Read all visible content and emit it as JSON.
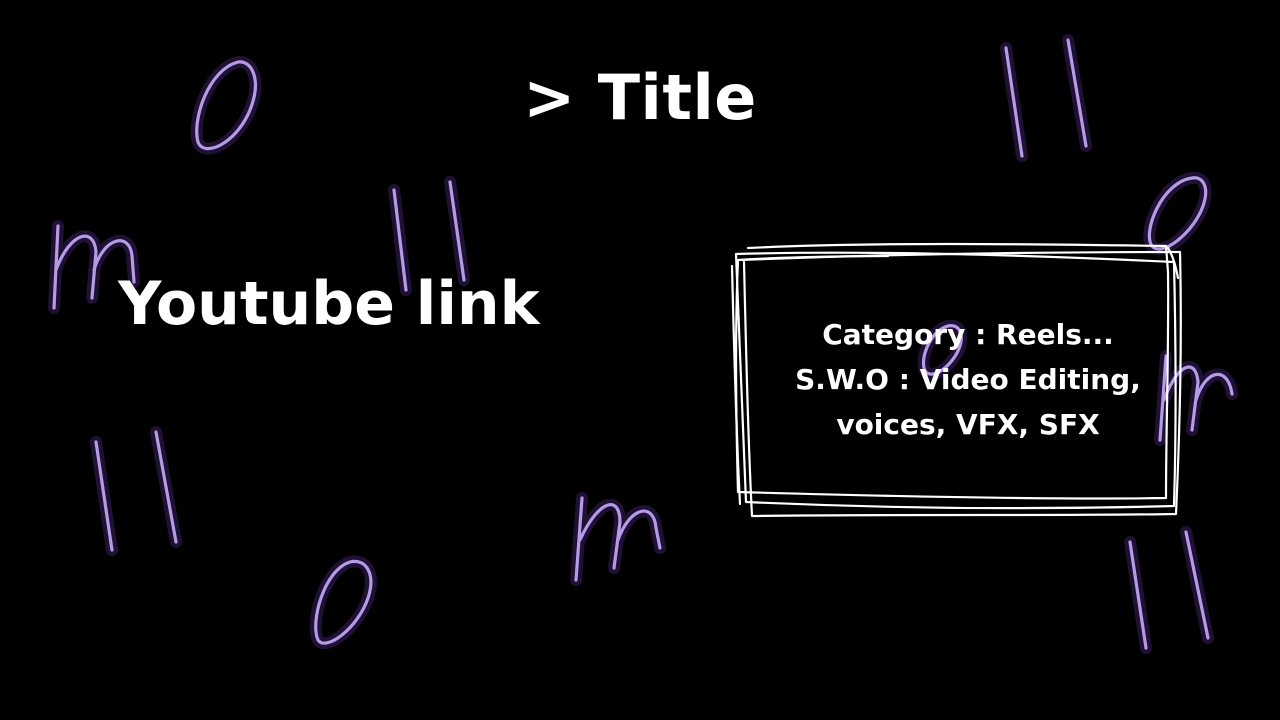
{
  "title": "> Title",
  "youtube_link": "Youtube link",
  "info_box": {
    "category_line": "Category : Reels...",
    "swo_line_1": "S.W.O : Video Editing,",
    "swo_line_2": "voices, VFX, SFX"
  },
  "decorations": {
    "icon_names": [
      "neon-letter-o-icon",
      "neon-letter-m-icon",
      "neon-pause-bars-icon"
    ],
    "neon_color": "#b69ae6",
    "background_color": "#000000"
  }
}
